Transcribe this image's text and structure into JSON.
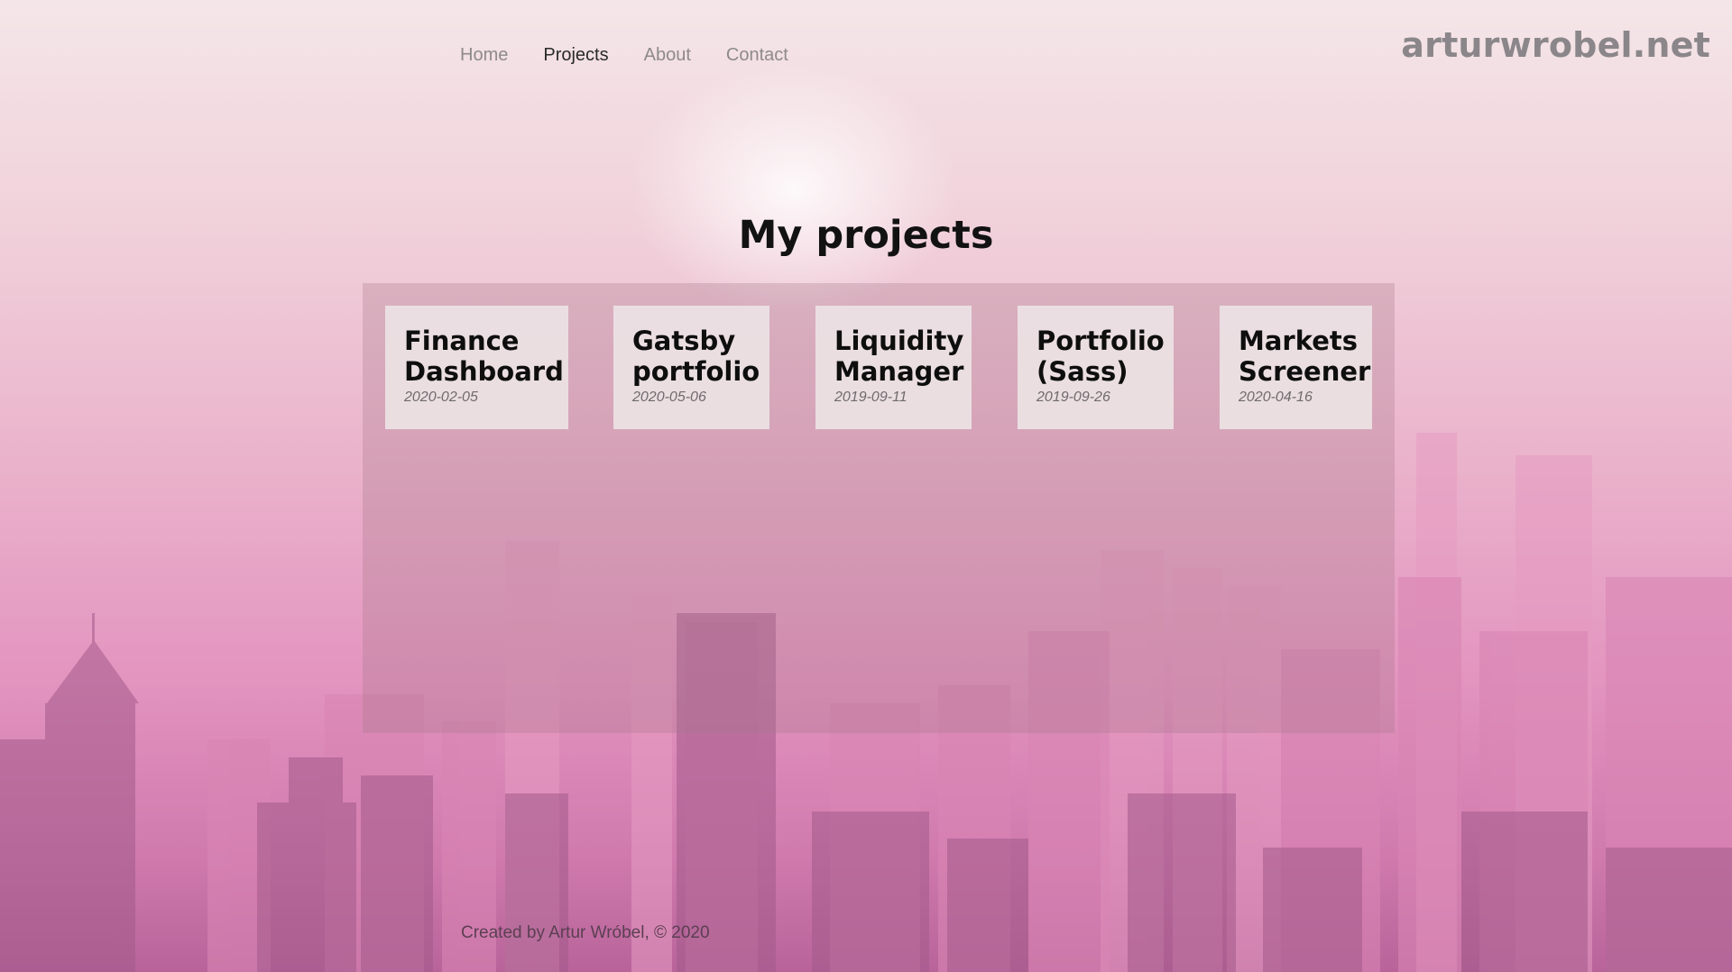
{
  "nav": {
    "items": [
      {
        "label": "Home",
        "active": false
      },
      {
        "label": "Projects",
        "active": true
      },
      {
        "label": "About",
        "active": false
      },
      {
        "label": "Contact",
        "active": false
      }
    ]
  },
  "brand": "arturwrobel.net",
  "page_title": "My projects",
  "projects": [
    {
      "name": "Finance\nDashboard",
      "date": "2020-02-05"
    },
    {
      "name": "Gatsby\nportfolio",
      "date": "2020-05-06"
    },
    {
      "name": "Liquidity\nManager",
      "date": "2019-09-11"
    },
    {
      "name": "Portfolio\n(Sass)",
      "date": "2019-09-26"
    },
    {
      "name": "Markets\nScreener",
      "date": "2020-04-16"
    }
  ],
  "footer": "Created by Artur Wróbel, © 2020",
  "colors": {
    "nav_active": "#2a2a2a",
    "nav_inactive": "#8e8a8c",
    "brand": "#8a8689",
    "card_bg": "#ece2e4"
  }
}
